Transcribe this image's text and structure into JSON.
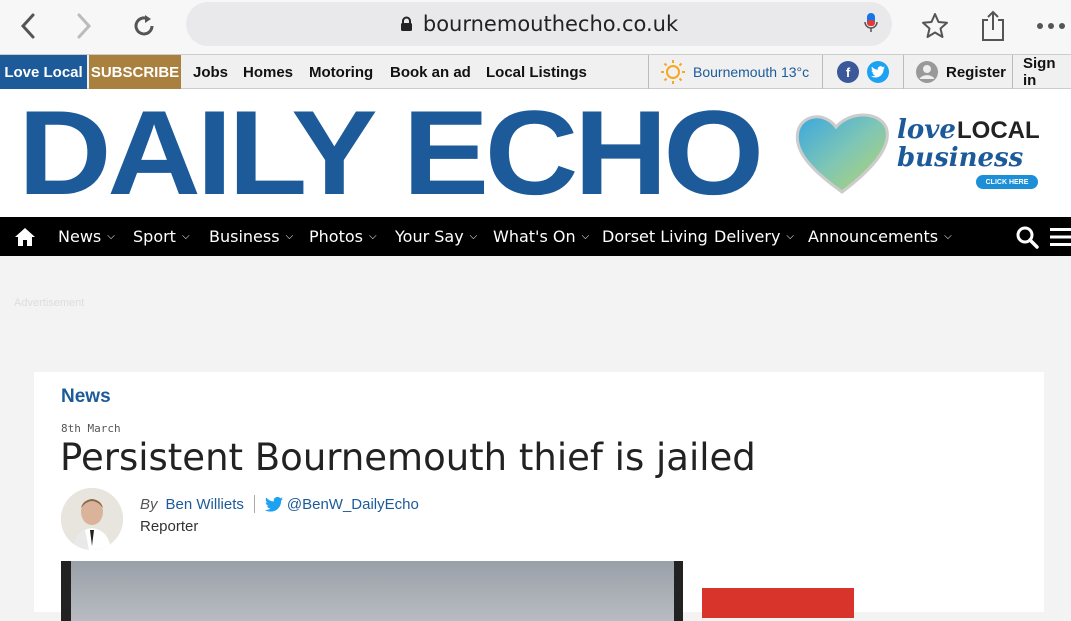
{
  "browser": {
    "url": "bournemouthecho.co.uk"
  },
  "topbar": {
    "love_local": "Love Local",
    "subscribe": "SUBSCRIBE",
    "links": [
      "Jobs",
      "Homes",
      "Motoring",
      "Book an ad",
      "Local Listings"
    ],
    "weather": "Bournemouth 13°c",
    "register": "Register",
    "sign_in": "Sign in"
  },
  "masthead": {
    "logo": "DAILY ECHO",
    "ad": {
      "love": "love",
      "local": "LOCAL",
      "business": "business",
      "cta": "CLICK HERE"
    }
  },
  "mainnav": {
    "items": [
      {
        "label": "News",
        "dropdown": true
      },
      {
        "label": "Sport",
        "dropdown": true
      },
      {
        "label": "Business",
        "dropdown": true
      },
      {
        "label": "Photos",
        "dropdown": true
      },
      {
        "label": "Your Say",
        "dropdown": true
      },
      {
        "label": "What's On",
        "dropdown": true
      },
      {
        "label": "Dorset Living",
        "dropdown": false
      },
      {
        "label": "Delivery",
        "dropdown": true
      },
      {
        "label": "Announcements",
        "dropdown": true
      }
    ]
  },
  "ad_label": "Advertisement",
  "article": {
    "section": "News",
    "date": "8th March",
    "headline": "Persistent Bournemouth thief is jailed",
    "by": "By",
    "author": "Ben Williets",
    "twitter_handle": "@BenW_DailyEcho",
    "role": "Reporter"
  },
  "colors": {
    "brand_blue": "#1c5a99",
    "subscribe_gold": "#a9803d",
    "nav_black": "#000000",
    "facebook": "#3b5998",
    "twitter": "#1da1f2"
  }
}
